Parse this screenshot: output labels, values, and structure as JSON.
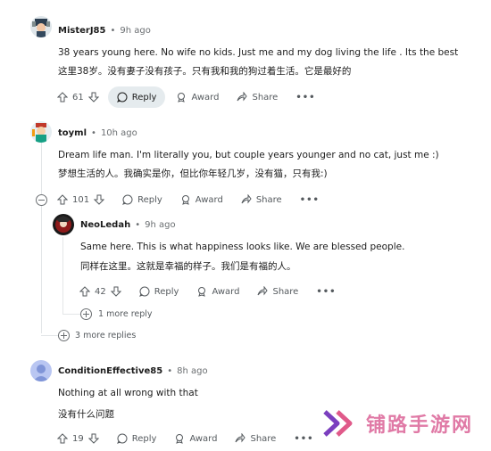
{
  "comments": [
    {
      "user": "MisterJ85",
      "time": "9h ago",
      "lines": [
        "38 years young here. No wife no kids. Just me and my dog living the life . Its the best",
        "这里38岁。没有妻子没有孩子。只有我和我的狗过着生活。它是最好的"
      ],
      "votes": "61"
    },
    {
      "user": "toyml",
      "time": "10h ago",
      "lines": [
        "Dream life man. I'm literally you, but couple years younger and no cat, just me :)",
        "梦想生活的人。我确实是你，但比你年轻几岁，没有猫，只有我:)"
      ],
      "votes": "101"
    },
    {
      "user": "NeoLedah",
      "time": "9h ago",
      "lines": [
        "Same here. This is what happiness looks like. We are blessed people.",
        "同样在这里。这就是幸福的样子。我们是有福的人。"
      ],
      "votes": "42",
      "more_replies": "1 more reply"
    },
    {
      "user": "ConditionEffective85",
      "time": "8h ago",
      "lines": [
        "Nothing at all wrong with that",
        "没有什么问题"
      ],
      "votes": "19"
    }
  ],
  "more_replies_toyml": "3 more replies",
  "actions": {
    "reply": "Reply",
    "award": "Award",
    "share": "Share",
    "dots": "•••"
  },
  "separator": "•",
  "watermark": {
    "text": "铺路手游网",
    "color": "#e05a8a"
  },
  "colors": {
    "accent_pill": "#e5ebee",
    "muted": "#6b6f72"
  }
}
